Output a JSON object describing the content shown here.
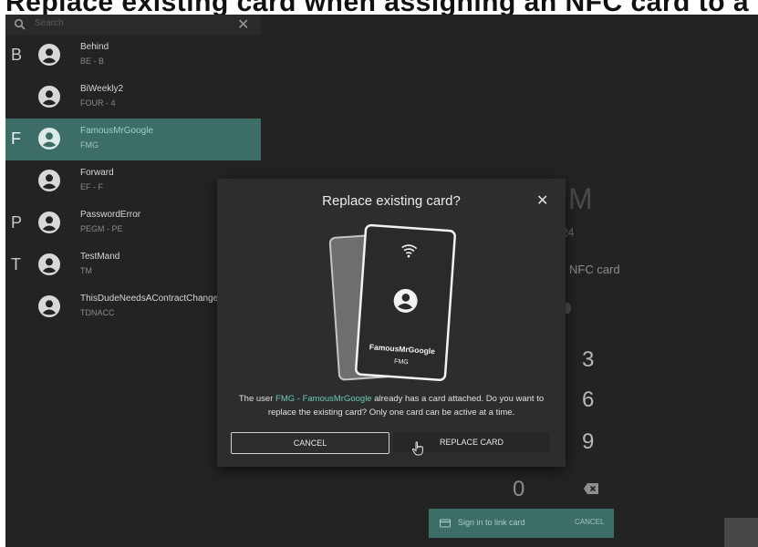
{
  "caption": "Replace existing card when assigning an NFC card to a user",
  "sidebar": {
    "search_placeholder": "Search",
    "close_glyph": "✕",
    "users": [
      {
        "letter": "B",
        "name": "Behind",
        "code": "BE - B",
        "selected": false
      },
      {
        "letter": "",
        "name": "BiWeekly2",
        "code": "FOUR - 4",
        "selected": false
      },
      {
        "letter": "F",
        "name": "FamousMrGoogle",
        "code": "FMG",
        "selected": true
      },
      {
        "letter": "",
        "name": "Forward",
        "code": "EF - F",
        "selected": false
      },
      {
        "letter": "P",
        "name": "PasswordError",
        "code": "PEGM - PE",
        "selected": false
      },
      {
        "letter": "T",
        "name": "TestMand",
        "code": "TM",
        "selected": false
      },
      {
        "letter": "",
        "name": "ThisDudeNeedsAContractChange",
        "code": "TDNACC",
        "selected": false
      }
    ]
  },
  "background": {
    "initials_fragment": "M",
    "date_fragment": "24",
    "nfc_fragment": "NFC card",
    "keys": {
      "k3": "3",
      "k6": "6",
      "k9": "9",
      "k0": "0"
    },
    "sign_in_label": "Sign in to link card",
    "sign_in_cancel": "CANCEL"
  },
  "modal": {
    "title": "Replace existing card?",
    "close_glyph": "✕",
    "card_name": "FamousMrGoogle",
    "card_code": "FMG",
    "message_before": "The user ",
    "message_user": "FMG - FamousMrGoogle",
    "message_after": " already has a card attached. Do you want to replace the existing card? Only one card can be active at a time.",
    "cancel_label": "CANCEL",
    "replace_label": "REPLACE CARD"
  },
  "colors": {
    "accent": "#3d6d67",
    "highlight_text": "#6cc7b7",
    "background": "#232323",
    "modal": "#2d2d2d"
  }
}
